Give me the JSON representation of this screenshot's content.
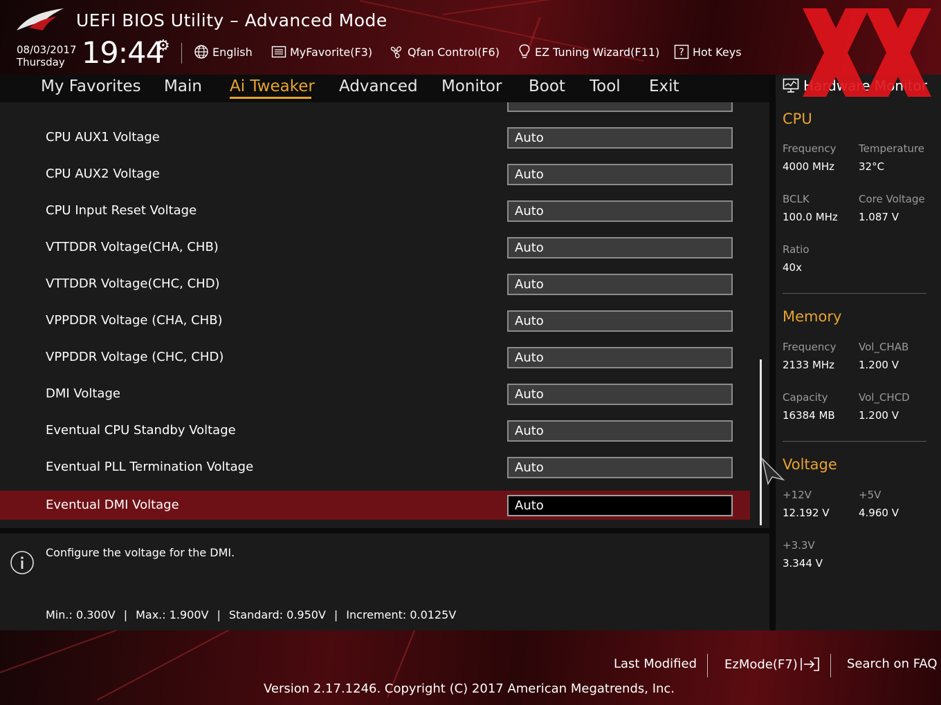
{
  "header": {
    "app_title": "UEFI BIOS Utility – Advanced Mode",
    "date": "08/03/2017",
    "day": "Thursday",
    "time": "19:44",
    "items": [
      {
        "label": "English",
        "icon": "globe-icon"
      },
      {
        "label": "MyFavorite(F3)",
        "icon": "favorite-list-icon"
      },
      {
        "label": "Qfan Control(F6)",
        "icon": "fan-icon"
      },
      {
        "label": "EZ Tuning Wizard(F11)",
        "icon": "lightbulb-icon"
      },
      {
        "label": "Hot Keys",
        "icon": "help-question-icon"
      }
    ]
  },
  "nav": {
    "tabs": [
      {
        "label": "My Favorites"
      },
      {
        "label": "Main"
      },
      {
        "label": "Ai Tweaker"
      },
      {
        "label": "Advanced"
      },
      {
        "label": "Monitor"
      },
      {
        "label": "Boot"
      },
      {
        "label": "Tool"
      },
      {
        "label": "Exit"
      }
    ],
    "active_tab": "Ai Tweaker"
  },
  "settings": [
    {
      "label": "CPU AUX1 Voltage",
      "value": "Auto"
    },
    {
      "label": "CPU AUX2 Voltage",
      "value": "Auto"
    },
    {
      "label": "CPU Input Reset Voltage",
      "value": "Auto"
    },
    {
      "label": "VTTDDR Voltage(CHA, CHB)",
      "value": "Auto"
    },
    {
      "label": "VTTDDR Voltage(CHC, CHD)",
      "value": "Auto"
    },
    {
      "label": "VPPDDR Voltage (CHA, CHB)",
      "value": "Auto"
    },
    {
      "label": "VPPDDR Voltage (CHC, CHD)",
      "value": "Auto"
    },
    {
      "label": "DMI Voltage",
      "value": "Auto"
    },
    {
      "label": "Eventual CPU Standby Voltage",
      "value": "Auto"
    },
    {
      "label": "Eventual PLL Termination Voltage",
      "value": "Auto"
    },
    {
      "label": "Eventual DMI Voltage",
      "value": "Auto",
      "selected": true
    }
  ],
  "help": {
    "description": "Configure the voltage for the DMI.",
    "min": "Min.: 0.300V",
    "max": "Max.: 1.900V",
    "standard": "Standard: 0.950V",
    "increment": "Increment: 0.0125V",
    "separator": "|"
  },
  "hardware_monitor": {
    "title": "Hardware Monitor",
    "cpu": {
      "title": "CPU",
      "frequency_label": "Frequency",
      "frequency": "4000 MHz",
      "temperature_label": "Temperature",
      "temperature": "32°C",
      "bclk_label": "BCLK",
      "bclk": "100.0 MHz",
      "core_voltage_label": "Core Voltage",
      "core_voltage": "1.087 V",
      "ratio_label": "Ratio",
      "ratio": "40x"
    },
    "memory": {
      "title": "Memory",
      "frequency_label": "Frequency",
      "frequency": "2133 MHz",
      "vol_chab_label": "Vol_CHAB",
      "vol_chab": "1.200 V",
      "capacity_label": "Capacity",
      "capacity": "16384 MB",
      "vol_chcd_label": "Vol_CHCD",
      "vol_chcd": "1.200 V"
    },
    "voltage": {
      "title": "Voltage",
      "v12_label": "+12V",
      "v12": "12.192 V",
      "v5_label": "+5V",
      "v5": "4.960 V",
      "v33_label": "+3.3V",
      "v33": "3.344 V"
    }
  },
  "footer": {
    "last_modified": "Last Modified",
    "ezmode": "EzMode(F7)",
    "search_faq": "Search on FAQ",
    "version": "Version 2.17.1246. Copyright (C) 2017 American Megatrends, Inc."
  },
  "colors": {
    "accent": "#e8a330",
    "selected_row": "#6e1116",
    "panel": "#1b1b1b",
    "brand_red": "#c0141c"
  }
}
